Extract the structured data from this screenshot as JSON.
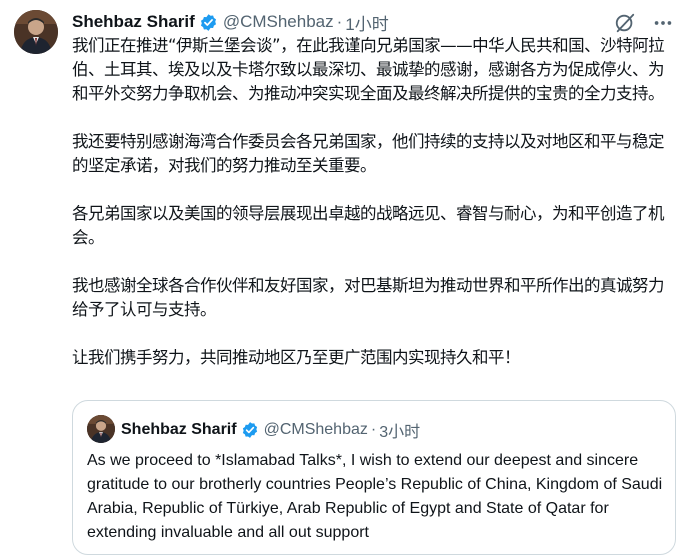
{
  "author": {
    "name": "Shehbaz Sharif",
    "handle": "@CMShehbaz",
    "separator": "·",
    "time": "1小时"
  },
  "icons": {
    "verified": "verified-badge-icon",
    "grok": "grok-icon",
    "more": "more-icon"
  },
  "tweet": {
    "paragraphs": [
      "我们正在推进“伊斯兰堡会谈”，在此我谨向兄弟国家——中华人民共和国、沙特阿拉伯、土耳其、埃及以及卡塔尔致以最深切、最诚挚的感谢，感谢各方为促成停火、为和平外交努力争取机会、为推动冲突实现全面及最终解决所提供的宝贵的全力支持。",
      "我还要特别感谢海湾合作委员会各兄弟国家，他们持续的支持以及对地区和平与稳定的坚定承诺，对我们的努力推动至关重要。",
      "各兄弟国家以及美国的领导层展现出卓越的战略远见、睿智与耐心，为和平创造了机会。",
      "我也感谢全球各合作伙伴和友好国家，对巴基斯坦为推动世界和平所作出的真诚努力给予了认可与支持。",
      "让我们携手努力，共同推动地区乃至更广范围内实现持久和平！"
    ]
  },
  "quote": {
    "name": "Shehbaz Sharif",
    "handle": "@CMShehbaz",
    "separator": "·",
    "time": "3小时",
    "text": "As we proceed to *Islamabad Talks*, I wish to extend our deepest and sincere gratitude to our brotherly countries People’s Republic of China, Kingdom of Saudi Arabia, Republic of Türkiye, Arab Republic of Egypt and State of Qatar for extending invaluable and all out support"
  },
  "colors": {
    "verified": "#1d9bf0",
    "secondary_text": "#536471",
    "border": "#cfd9de"
  }
}
